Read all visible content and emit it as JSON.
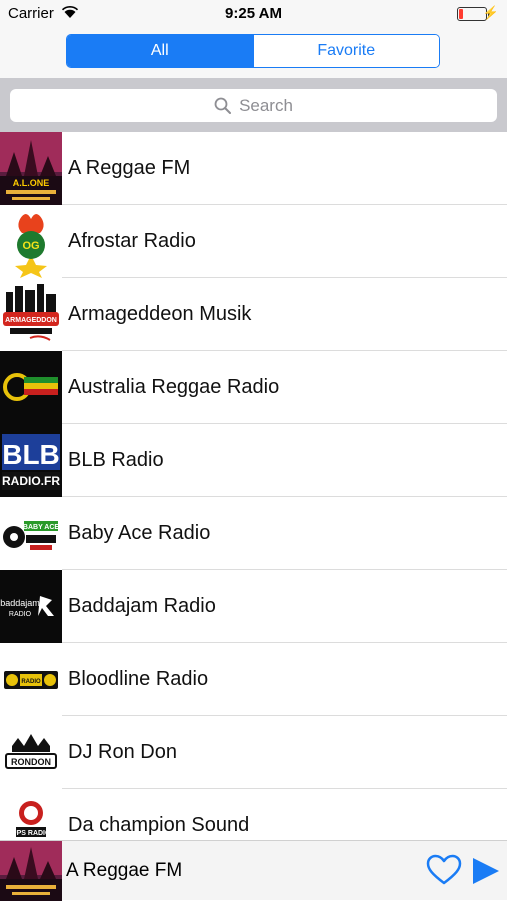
{
  "status_bar": {
    "carrier": "Carrier",
    "time": "9:25 AM",
    "battery_level": 0.15
  },
  "segment": {
    "all_label": "All",
    "favorite_label": "Favorite",
    "selected": "All"
  },
  "search": {
    "placeholder": "Search"
  },
  "stations": [
    {
      "name": "A Reggae FM",
      "logo_text": "A.L.ONE"
    },
    {
      "name": "Afrostar Radio",
      "logo_text": "OG"
    },
    {
      "name": "Armageddeon Musik",
      "logo_text": "ARMAGEDDON"
    },
    {
      "name": "Australia Reggae Radio",
      "logo_text": ""
    },
    {
      "name": "BLB Radio",
      "logo_text": "BLB"
    },
    {
      "name": "Baby Ace Radio",
      "logo_text": "BABY ACE"
    },
    {
      "name": "Baddajam Radio",
      "logo_text": "baddajam"
    },
    {
      "name": "Bloodline Radio",
      "logo_text": "RADIO"
    },
    {
      "name": "DJ Ron Don",
      "logo_text": "RONDON"
    },
    {
      "name": "Da champion Sound",
      "logo_text": "UPS RADIO"
    }
  ],
  "player": {
    "title": "A Reggae FM"
  },
  "colors": {
    "accent": "#1a7cf5"
  }
}
